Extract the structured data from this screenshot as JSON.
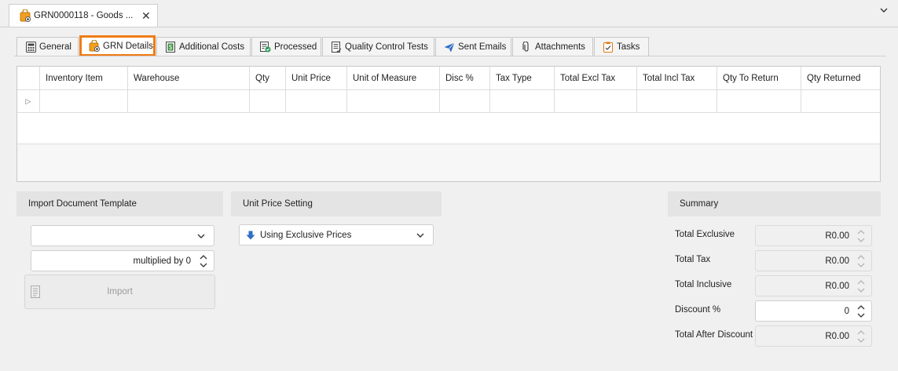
{
  "window": {
    "doc_tab_label": "GRN0000118 - Goods ...",
    "close_glyph": "✕",
    "collapse_glyph": "⌄"
  },
  "tabs": [
    {
      "label": "General",
      "icon": "calculator-icon"
    },
    {
      "label": "GRN Details",
      "icon": "bag-icon"
    },
    {
      "label": "Additional Costs",
      "icon": "dollar-document-icon"
    },
    {
      "label": "Processed",
      "icon": "processed-check-icon"
    },
    {
      "label": "Quality Control Tests",
      "icon": "checklist-icon"
    },
    {
      "label": "Sent Emails",
      "icon": "send-icon"
    },
    {
      "label": "Attachments",
      "icon": "paperclip-icon"
    },
    {
      "label": "Tasks",
      "icon": "clipboard-icon"
    }
  ],
  "active_tab": "GRN Details",
  "grid": {
    "columns": [
      "Inventory Item",
      "Warehouse",
      "Qty",
      "Unit Price",
      "Unit of Measure",
      "Disc %",
      "Tax Type",
      "Total Excl Tax",
      "Total Incl Tax",
      "Qty To Return",
      "Qty Returned"
    ],
    "new_row_indicator": "▷"
  },
  "import_section": {
    "title": "Import Document Template",
    "template_value": "",
    "multiplier_text": "multiplied by 0",
    "import_label": "Import"
  },
  "unit_price_section": {
    "title": "Unit Price Setting",
    "selected": "Using Exclusive Prices"
  },
  "summary": {
    "title": "Summary",
    "rows": [
      {
        "label": "Total Exclusive",
        "value": "R0.00",
        "editable": false
      },
      {
        "label": "Total Tax",
        "value": "R0.00",
        "editable": false
      },
      {
        "label": "Total Inclusive",
        "value": "R0.00",
        "editable": false
      },
      {
        "label": "Discount %",
        "value": "0",
        "editable": true
      },
      {
        "label": "Total After Discount",
        "value": "R0.00",
        "editable": false
      }
    ]
  },
  "colors": {
    "accent_orange": "#f07b14",
    "blue_arrow": "#2f6fc4",
    "background": "#f0f0f0"
  }
}
